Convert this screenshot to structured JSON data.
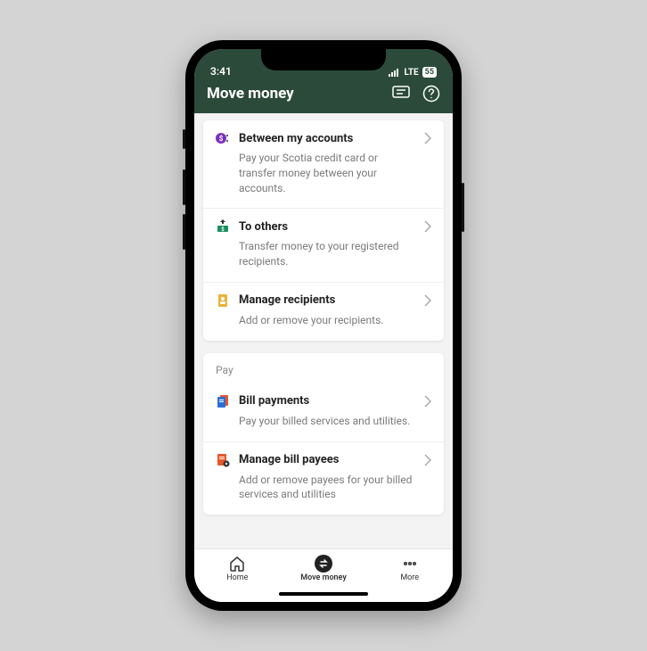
{
  "status": {
    "time": "3:41",
    "network": "LTE",
    "battery": "55"
  },
  "header": {
    "title": "Move money"
  },
  "groups": [
    {
      "rows": [
        {
          "title": "Between my accounts",
          "desc": "Pay your Scotia credit card or transfer money between your accounts.",
          "icon": "dollar-circle-icon",
          "icon_color": "#7b2fbf"
        },
        {
          "title": "To others",
          "desc": "Transfer money to your registered recipients.",
          "icon": "cash-icon",
          "icon_color": "#1a8f5d"
        },
        {
          "title": "Manage recipients",
          "desc": "Add or remove your recipients.",
          "icon": "person-card-icon",
          "icon_color": "#e8b33a"
        }
      ]
    },
    {
      "label": "Pay",
      "rows": [
        {
          "title": "Bill payments",
          "desc": "Pay your billed services and utilities.",
          "icon": "document-icon",
          "icon_color": "#2a6fd6"
        },
        {
          "title": "Manage bill payees",
          "desc": "Add or remove payees for your billed services and utilities",
          "icon": "document-gear-icon",
          "icon_color": "#e8572a"
        }
      ]
    }
  ],
  "tabbar": {
    "items": [
      {
        "label": "Home",
        "icon": "home-icon",
        "active": false
      },
      {
        "label": "Move money",
        "icon": "transfer-icon",
        "active": true
      },
      {
        "label": "More",
        "icon": "more-icon",
        "active": false
      }
    ]
  }
}
